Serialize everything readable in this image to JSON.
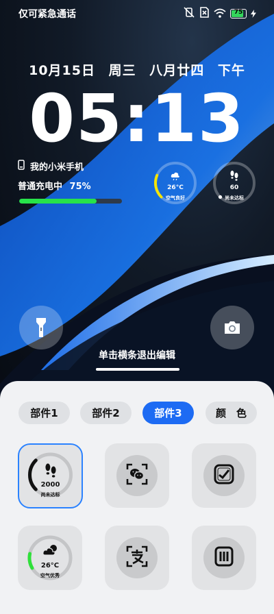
{
  "status_bar": {
    "carrier_text": "仅可紧急通话",
    "battery_level": "75",
    "battery_fraction": 0.75,
    "icons": [
      "vibrate-off-icon",
      "no-sim-icon",
      "wifi-icon",
      "battery-icon",
      "charging-bolt-icon"
    ]
  },
  "lockscreen": {
    "date": {
      "date": "10月15日",
      "weekday": "周三",
      "lunar": "八月廿四",
      "period": "下午"
    },
    "clock": "05:13",
    "device_name": "我的小米手机",
    "charging_label": "普通充电中",
    "charging_percent": "75%",
    "charge_fraction": 0.75,
    "weather": {
      "temperature": "26°C",
      "status": "空气良好",
      "fraction": 0.25,
      "accent": "#f5e400"
    },
    "steps": {
      "value": "60",
      "status": "尚未达标",
      "fraction": 0.02,
      "accent": "#ffffff"
    },
    "flashlight_icon": "flashlight-icon",
    "camera_icon": "camera-icon",
    "hint": "单击横条退出编辑"
  },
  "editor": {
    "tabs": [
      {
        "label": "部件1",
        "active": false
      },
      {
        "label": "部件2",
        "active": false
      },
      {
        "label": "部件3",
        "active": true
      },
      {
        "label": "颜　色",
        "active": false
      }
    ],
    "tiles": [
      {
        "type": "steps",
        "value": "2000",
        "status": "尚未达标",
        "selected": true
      },
      {
        "type": "icon",
        "icon": "wechat-scan-icon"
      },
      {
        "type": "icon",
        "icon": "alipay-app-icon"
      },
      {
        "type": "weather",
        "value": "26°C",
        "status": "空气优秀",
        "accent": "#2fe03a"
      },
      {
        "type": "icon",
        "icon": "alipay-scan-icon"
      },
      {
        "type": "icon",
        "icon": "bus-card-icon"
      }
    ]
  }
}
